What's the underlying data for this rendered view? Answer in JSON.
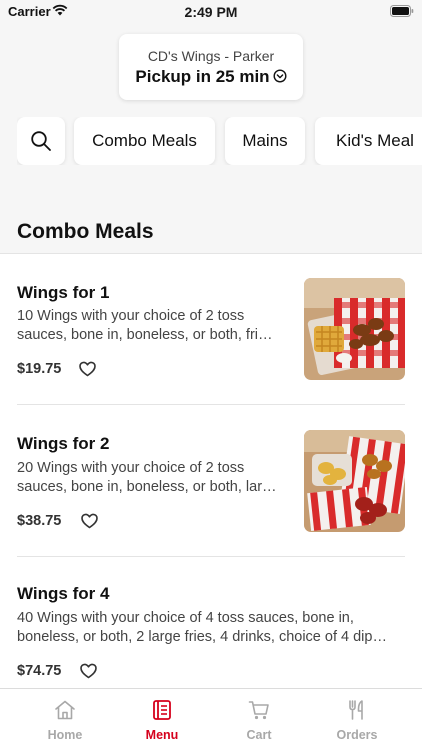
{
  "status_bar": {
    "carrier": "Carrier",
    "time": "2:49 PM"
  },
  "location": {
    "store_name": "CD's Wings - Parker",
    "pickup_text": "Pickup in 25 min"
  },
  "categories": [
    {
      "label": "Combo Meals"
    },
    {
      "label": "Mains"
    },
    {
      "label": "Kid's Meal"
    }
  ],
  "section": {
    "title": "Combo Meals"
  },
  "items": [
    {
      "name": "Wings for 1",
      "description": "10 Wings with your choice of 2 toss sauces, bone in, boneless, or both, fri…",
      "price": "$19.75",
      "favorited": false
    },
    {
      "name": "Wings for 2",
      "description": "20 Wings with your choice of 2 toss sauces, bone in, boneless, or both, lar…",
      "price": "$38.75",
      "favorited": false
    },
    {
      "name": "Wings for 4",
      "description": "40 Wings with your choice of 4 toss sauces, bone in, boneless, or both, 2 large fries, 4 drinks, choice of 4 dip…",
      "price": "$74.75",
      "favorited": false
    }
  ],
  "tabs": [
    {
      "label": "Home",
      "icon": "home-icon",
      "active": false
    },
    {
      "label": "Menu",
      "icon": "menu-icon",
      "active": true
    },
    {
      "label": "Cart",
      "icon": "cart-icon",
      "active": false
    },
    {
      "label": "Orders",
      "icon": "orders-icon",
      "active": false
    }
  ],
  "colors": {
    "accent": "#d5001c",
    "inactive_tab": "#a8a8a8",
    "header_bg": "#f6f6f6"
  }
}
